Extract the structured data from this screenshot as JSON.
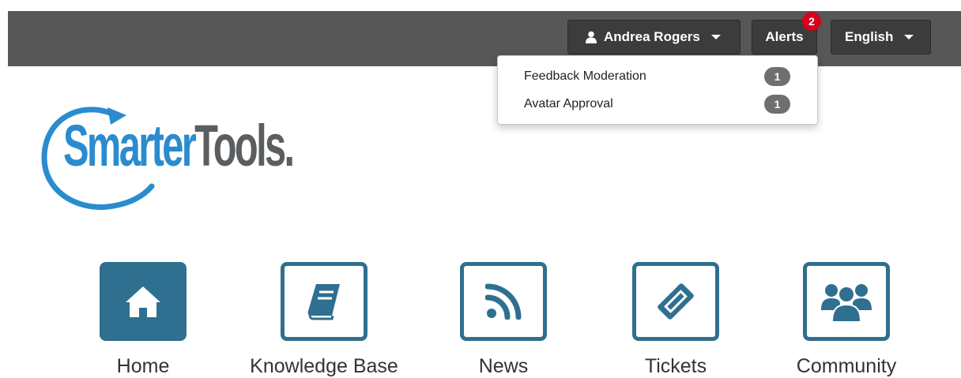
{
  "header": {
    "user_name": "Andrea Rogers",
    "alerts_label": "Alerts",
    "alerts_count": "2",
    "language": "English"
  },
  "alerts_dropdown": {
    "items": [
      {
        "label": "Feedback Moderation",
        "count": "1"
      },
      {
        "label": "Avatar Approval",
        "count": "1"
      }
    ]
  },
  "logo": {
    "part1": "Smarter",
    "part2": "Tools."
  },
  "nav": {
    "items": [
      {
        "label": "Home",
        "icon": "home-icon",
        "active": true
      },
      {
        "label": "Knowledge Base",
        "icon": "book-icon"
      },
      {
        "label": "News",
        "icon": "rss-icon"
      },
      {
        "label": "Tickets",
        "icon": "ticket-icon"
      },
      {
        "label": "Community",
        "icon": "users-icon"
      }
    ]
  },
  "colors": {
    "accent": "#2f6f90",
    "brand": "#2a8ccf",
    "alert": "#d9001b"
  }
}
